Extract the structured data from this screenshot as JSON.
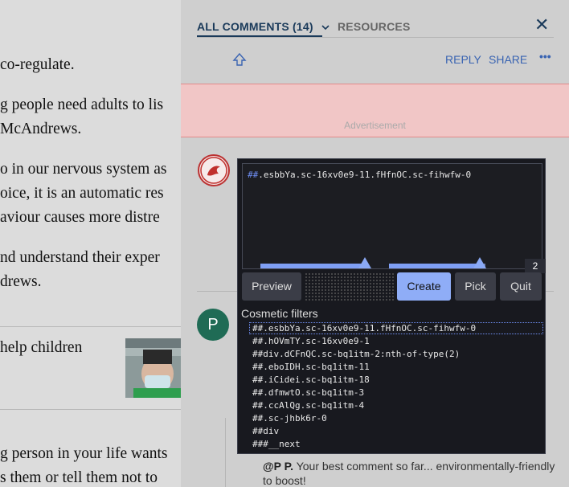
{
  "article": {
    "lines": [
      "co-regulate.",
      "g people need adults to lis",
      "McAndrews.",
      "o in our nervous system as",
      "oice, it is an automatic res",
      "aviour causes more distre",
      "nd understand their exper",
      "drews.",
      "help children",
      "g person in your life wants",
      "s them or tell them not to"
    ]
  },
  "comments_panel": {
    "tab_all": "ALL COMMENTS (14)",
    "tab_resources": "RESOURCES",
    "reply": "REPLY",
    "share": "SHARE",
    "advertisement": "Advertisement",
    "avatar_letter": "P",
    "reply_author": "@P P.",
    "reply_body": "Your best comment so far... environmentally-friendly to boost!"
  },
  "picker": {
    "selector_prefix": "##",
    "selector": ".esbbYa.sc-16xv0e9-11.fHfnOC.sc-fihwfw-0",
    "count": "2",
    "buttons": {
      "preview": "Preview",
      "create": "Create",
      "pick": "Pick",
      "quit": "Quit"
    },
    "filters_title": "Cosmetic filters",
    "filters": [
      "##.esbbYa.sc-16xv0e9-11.fHfnOC.sc-fihwfw-0",
      "##.hOVmTY.sc-16xv0e9-1",
      "##div.dCFnQC.sc-bq1itm-2:nth-of-type(2)",
      "##.eboIDH.sc-bq1itm-11",
      "##.iCidei.sc-bq1itm-18",
      "##.dfmwtO.sc-bq1itm-3",
      "##.ccAlQg.sc-bq1itm-4",
      "##.sc-jhbk6r-0",
      "##div",
      "###__next"
    ]
  },
  "colors": {
    "accent": "#8fadf7",
    "link": "#3a64b2",
    "ad_bg": "#f1c6c6",
    "avatar_green": "#1f6b55"
  }
}
